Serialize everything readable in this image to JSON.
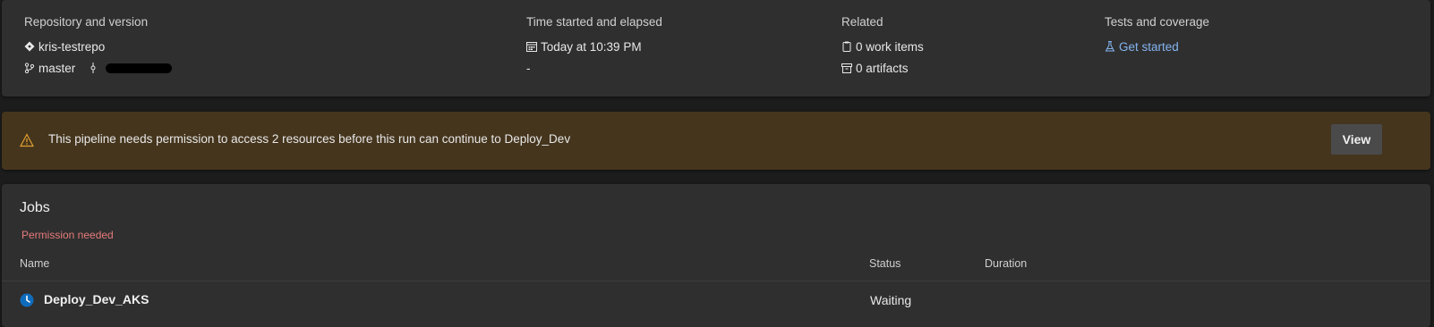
{
  "summary": {
    "repo": {
      "label": "Repository and version",
      "repo_name": "kris-testrepo",
      "branch": "master"
    },
    "time": {
      "label": "Time started and elapsed",
      "started": "Today at 10:39 PM",
      "elapsed": "-"
    },
    "related": {
      "label": "Related",
      "work_items": "0 work items",
      "artifacts": "0 artifacts"
    },
    "tests": {
      "label": "Tests and coverage",
      "link": "Get started"
    }
  },
  "banner": {
    "message": "This pipeline needs permission to access 2 resources before this run can continue to Deploy_Dev",
    "button": "View"
  },
  "jobs": {
    "title": "Jobs",
    "status_note": "Permission needed",
    "columns": {
      "name": "Name",
      "status": "Status",
      "duration": "Duration"
    },
    "rows": [
      {
        "name": "Deploy_Dev_AKS",
        "status": "Waiting",
        "duration": ""
      }
    ]
  },
  "colors": {
    "card_bg": "#2f2f2f",
    "banner_bg": "#45351d",
    "warning": "#e0a030",
    "link": "#84b4f0",
    "error_text": "#e77a7a",
    "job_icon": "#0f6cbd"
  }
}
